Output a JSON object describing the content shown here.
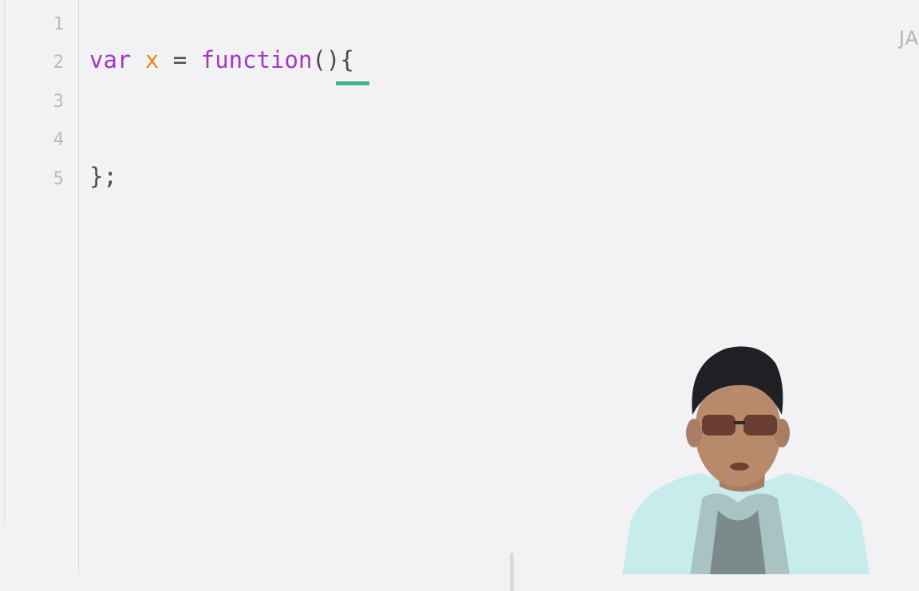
{
  "editor": {
    "language_label": "JA",
    "line_numbers": [
      "1",
      "2",
      "3",
      "4",
      "5"
    ],
    "code": {
      "line2": {
        "keyword_var": "var",
        "identifier": "x",
        "operator": "=",
        "keyword_function": "function",
        "parens": "()",
        "brace_open": "{"
      },
      "line5": {
        "brace_close": "}",
        "semicolon": ";"
      }
    }
  },
  "colors": {
    "background": "#f2f2f4",
    "keyword": "#a437c6",
    "identifier": "#e4871f",
    "cursor_underline": "#3fb58a",
    "line_number": "#b9b9be"
  },
  "presenter": {
    "icon": "presenter-webcam-overlay"
  }
}
